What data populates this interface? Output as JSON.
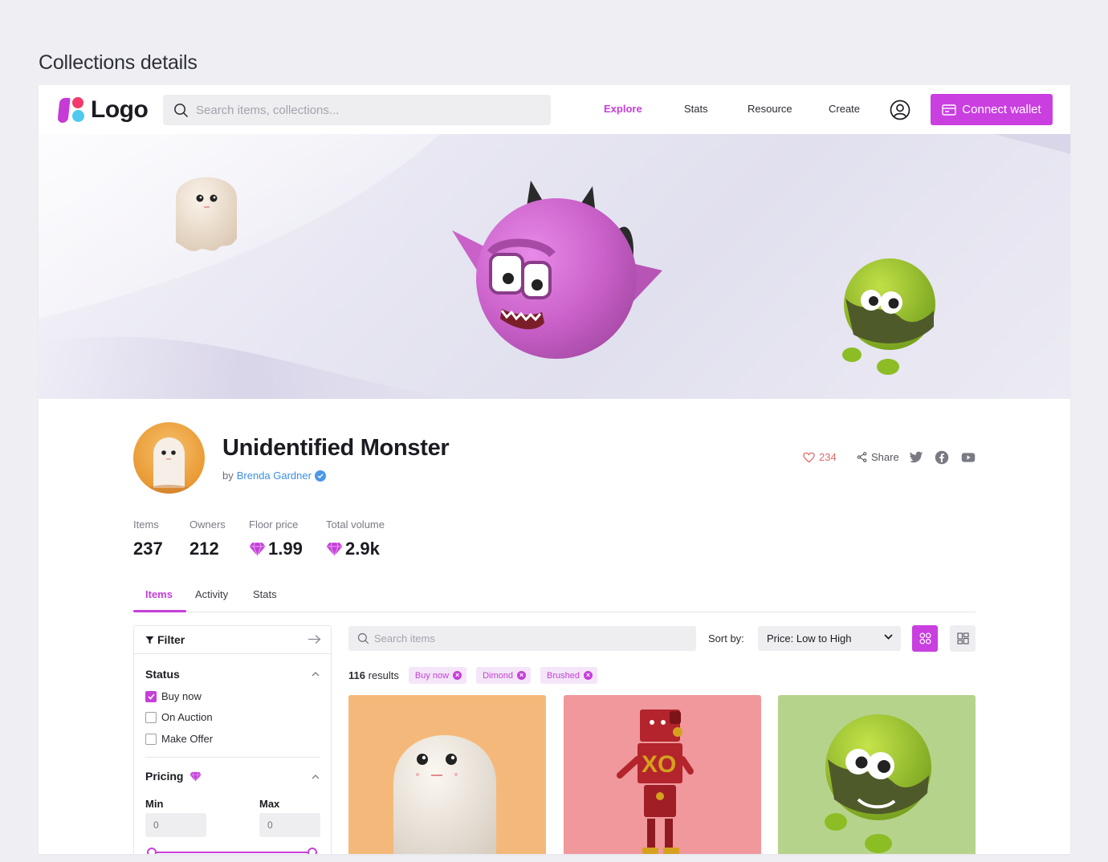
{
  "page": {
    "title": "Collections details"
  },
  "header": {
    "logo_text": "Logo",
    "search_placeholder": "Search items, collections...",
    "nav": [
      {
        "label": "Explore",
        "active": true
      },
      {
        "label": "Stats",
        "active": false
      },
      {
        "label": "Resource",
        "active": false
      },
      {
        "label": "Create",
        "active": false
      }
    ],
    "connect_label": "Connect wallet",
    "accent": "#c93fe0"
  },
  "collection": {
    "name": "Unidentified Monster",
    "by_prefix": "by",
    "author": "Brenda Gardner",
    "likes": "234",
    "share_label": "Share",
    "socials": [
      "twitter-icon",
      "facebook-icon",
      "youtube-icon"
    ]
  },
  "stats": [
    {
      "label": "Items",
      "value": "237",
      "currency": false
    },
    {
      "label": "Owners",
      "value": "212",
      "currency": false
    },
    {
      "label": "Floor price",
      "value": "1.99",
      "currency": true
    },
    {
      "label": "Total volume",
      "value": "2.9k",
      "currency": true
    }
  ],
  "tabs": [
    {
      "label": "Items",
      "active": true
    },
    {
      "label": "Activity",
      "active": false
    },
    {
      "label": "Stats",
      "active": false
    }
  ],
  "filter": {
    "title": "Filter",
    "status_title": "Status",
    "status_options": [
      {
        "label": "Buy now",
        "checked": true
      },
      {
        "label": "On Auction",
        "checked": false
      },
      {
        "label": "Make Offer",
        "checked": false
      }
    ],
    "pricing_title": "Pricing",
    "min_label": "Min",
    "max_label": "Max",
    "min_placeholder": "0",
    "max_placeholder": "0"
  },
  "results": {
    "search_placeholder": "Search items",
    "sort_label": "Sort by:",
    "sort_value": "Price: Low to High",
    "count": "116",
    "count_suffix": "results",
    "chips": [
      "Buy now",
      "Dimond",
      "Brushed"
    ]
  },
  "cards": [
    {
      "bg": "#f4b97a",
      "subject": "ghost"
    },
    {
      "bg": "#f0989c",
      "subject": "robot"
    },
    {
      "bg": "#b6d38c",
      "subject": "green-monster"
    }
  ]
}
